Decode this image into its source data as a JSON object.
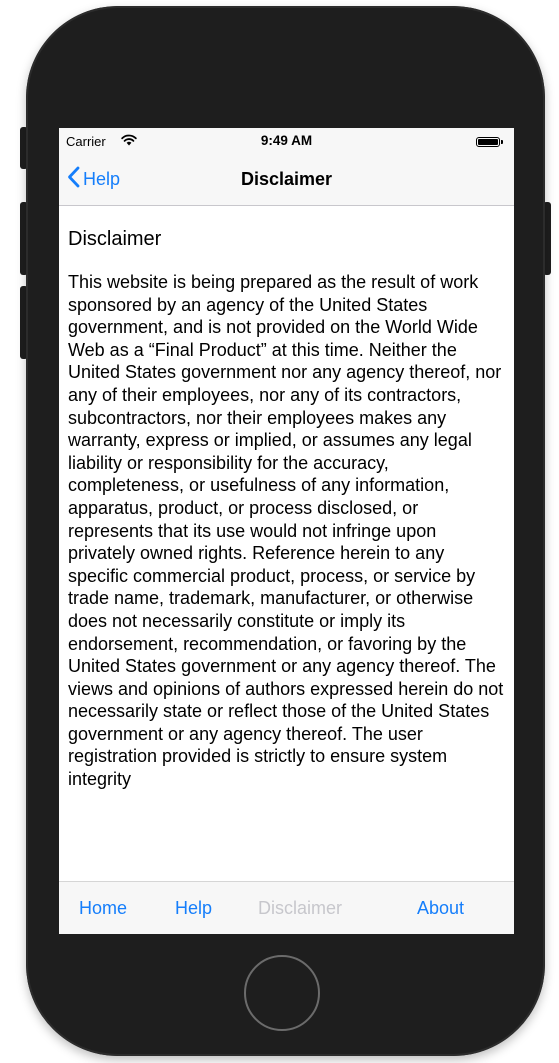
{
  "status_bar": {
    "carrier": "Carrier",
    "time": "9:49 AM",
    "wifi_icon": "wifi-icon",
    "battery_icon": "battery-full-icon"
  },
  "nav_bar": {
    "back_label": "Help",
    "back_icon": "chevron-left-icon",
    "title": "Disclaimer"
  },
  "content": {
    "heading": "Disclaimer",
    "body": "This website is being prepared as the result of work sponsored by an agency of the United States government, and is not provided on the World Wide Web as a “Final Product” at this time. Neither the United States government nor any agency thereof, nor any of their employees, nor any of its contractors, subcontractors, nor their employees makes any warranty, express or implied, or assumes any legal liability or responsibility for the accuracy, completeness, or usefulness of any information, apparatus, product, or process disclosed, or represents that its use would not infringe upon privately owned rights. Reference herein to any specific commercial product, process, or service by trade name, trademark, manufacturer, or otherwise does not necessarily constitute or imply its endorsement, recommendation, or favoring by the United States government or any agency thereof. The views and opinions of authors expressed herein do not necessarily state or reflect those of the United States government or any agency thereof. The user registration provided is strictly to ensure system integrity"
  },
  "tab_bar": {
    "items": [
      {
        "label": "Home",
        "enabled": true
      },
      {
        "label": "Help",
        "enabled": true
      },
      {
        "label": "Disclaimer",
        "enabled": false
      },
      {
        "label": "About",
        "enabled": true
      }
    ]
  },
  "colors": {
    "accent": "#157efb",
    "disabled": "#c7c7cc",
    "bar_background": "#f7f7f7",
    "device_body": "#1e1e1e"
  }
}
